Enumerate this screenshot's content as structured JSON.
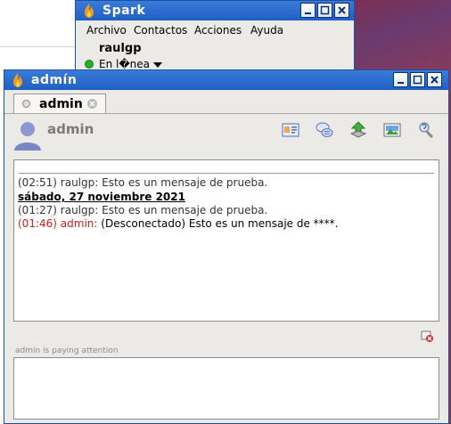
{
  "spark_window": {
    "title": "Spark",
    "menu": [
      "Archivo",
      "Contactos",
      "Acciones",
      "Ayuda"
    ],
    "username": "raulgp",
    "status": "En l�nea"
  },
  "chat_window": {
    "title": "admín",
    "tab_label": "admin",
    "contact_name": "admin",
    "toolbar_icons": [
      "vcard-icon",
      "chat-bubbles-icon",
      "send-file-icon",
      "screenshot-icon",
      "settings-icon"
    ],
    "messages": [
      {
        "time": "(02:51)",
        "sender": "raulgp:",
        "text": "Esto es un mensaje de prueba.",
        "style": "normal"
      },
      {
        "day": "sábado, 27 noviembre 2021"
      },
      {
        "time": "(01:27)",
        "sender": "raulgp:",
        "text": "Esto es un mensaje de prueba.",
        "style": "normal"
      },
      {
        "time": "(01:46)",
        "sender": "admin:",
        "text": "(Desconectado) Esto es un mensaje de ****.",
        "style": "red"
      }
    ],
    "typing_notice": "admin is paying attention",
    "input_value": ""
  },
  "colors": {
    "titlebar": "#1f5fc4",
    "window_bg": "#eceae6",
    "status_online": "#22b022",
    "offline_message": "#d21c1c"
  }
}
